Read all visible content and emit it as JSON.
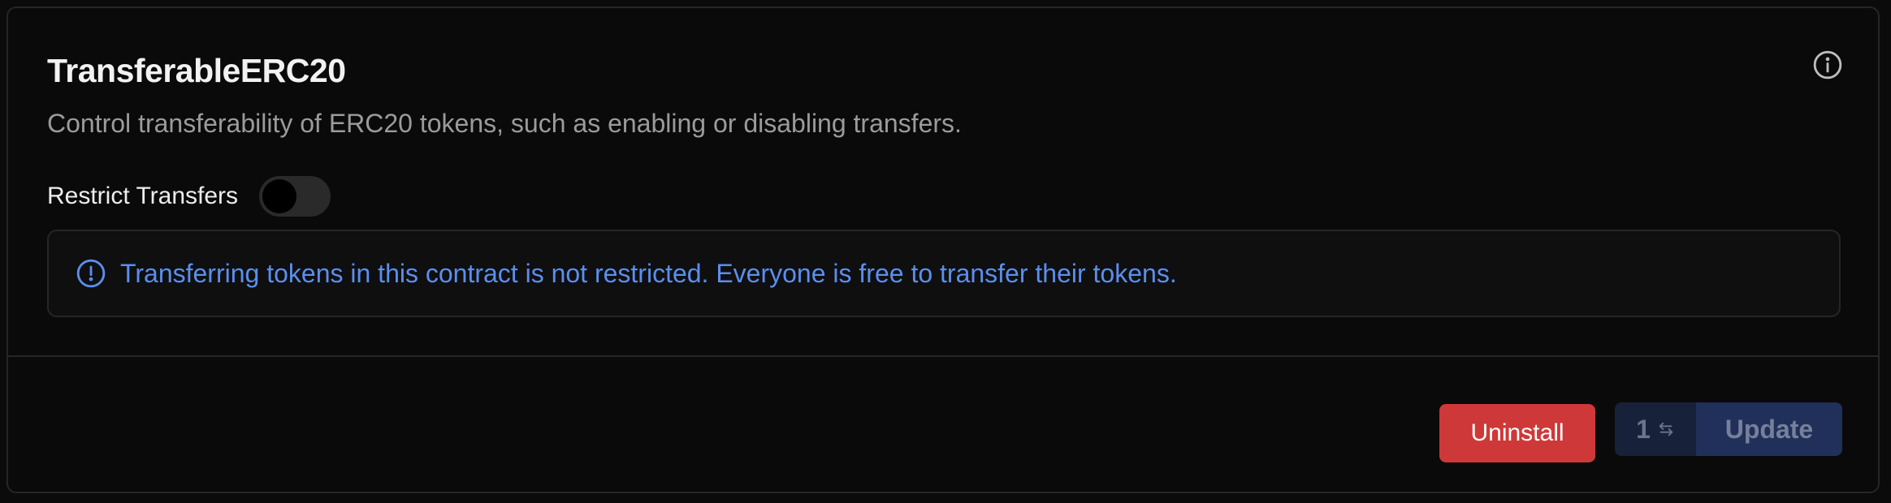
{
  "extension": {
    "title": "TransferableERC20",
    "description": "Control transferability of ERC20 tokens, such as enabling or disabling transfers.",
    "info_icon": "info-circle-icon"
  },
  "restrict_transfers": {
    "label": "Restrict Transfers",
    "enabled": false
  },
  "alert": {
    "icon": "alert-circle-icon",
    "text": "Transferring tokens in this contract is not restricted. Everyone is free to transfer their tokens.",
    "color": "#5b8ef0"
  },
  "footer": {
    "uninstall_label": "Uninstall",
    "uninstall_color": "#cf3838",
    "pending_count": "1",
    "swap_icon": "swap-arrows-icon",
    "update_label": "Update"
  }
}
